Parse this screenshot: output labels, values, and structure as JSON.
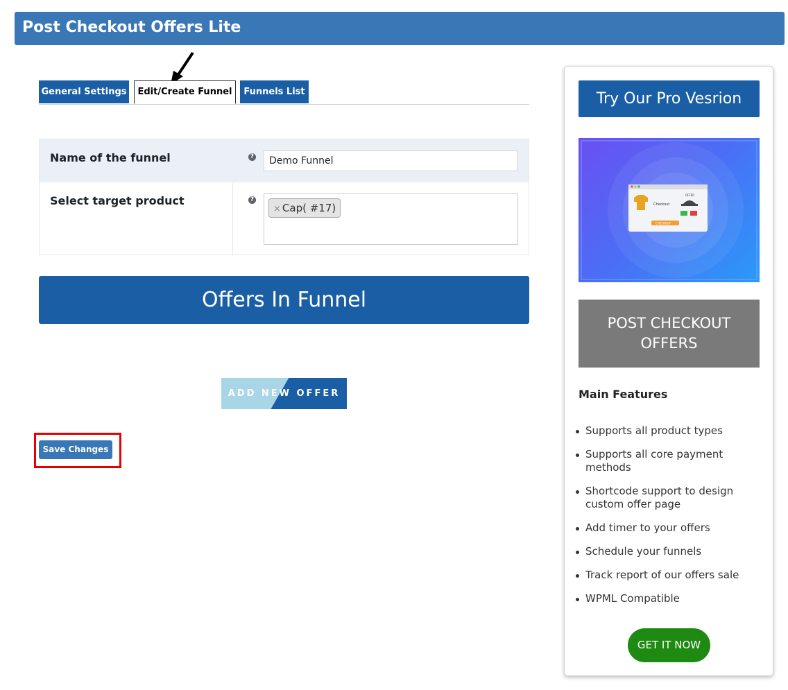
{
  "header": {
    "title": "Post Checkout Offers Lite"
  },
  "tabs": [
    {
      "label": "General Settings"
    },
    {
      "label": "Edit/Create Funnel"
    },
    {
      "label": "Funnels List"
    }
  ],
  "form": {
    "funnel_name_label": "Name of the funnel",
    "funnel_name_value": "Demo Funnel",
    "target_product_label": "Select target product",
    "target_product_chip": "Cap( #17)",
    "chip_remove": "×",
    "help_glyph": "?"
  },
  "offers": {
    "title": "Offers In Funnel",
    "add_button": "ADD NEW OFFER"
  },
  "actions": {
    "save_label": "Save Changes"
  },
  "sidebar": {
    "try_pro": "Try Our Pro Vesrion",
    "promo_image": {
      "checkout_text": "Checkout",
      "offer_text": "OFFER",
      "checkout_button": "CHECKOUT"
    },
    "post_box_line1": "POST CHECKOUT",
    "post_box_line2": "OFFERS",
    "features_title": "Main Features",
    "features": [
      "Supports all product types",
      "Supports all core payment methods",
      "Shortcode support to design custom offer page",
      "Add timer to your offers",
      "Schedule your funnels",
      "Track report of our offers sale",
      "WPML Compatible"
    ],
    "get_it": "GET IT NOW"
  },
  "colors": {
    "header_bg": "#3a77b7",
    "primary_blue": "#1a5fa6",
    "highlight_red": "#e40000",
    "cta_green": "#1e8a12",
    "post_box_gray": "#7a7a7a"
  }
}
